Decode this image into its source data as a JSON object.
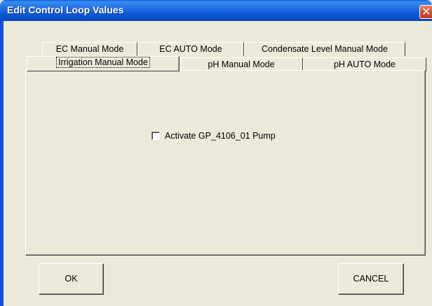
{
  "window": {
    "title": "Edit Control Loop Values",
    "close_glyph": "✕"
  },
  "tabs": {
    "row_back": [
      {
        "label": "EC Manual Mode"
      },
      {
        "label": "EC AUTO Mode"
      },
      {
        "label": "Condensate Level Manual Mode"
      }
    ],
    "row_front": [
      {
        "label": "Irrigation Manual Mode",
        "selected": true
      },
      {
        "label": "pH Manual Mode",
        "selected": false
      },
      {
        "label": "pH AUTO Mode",
        "selected": false
      }
    ]
  },
  "panel": {
    "checkbox": {
      "label": "Activate GP_4106_01 Pump",
      "checked": false
    }
  },
  "buttons": {
    "ok_label": "OK",
    "cancel_label": "CANCEL"
  },
  "colors": {
    "titlebar": "#0a54d2",
    "face": "#ece9d8",
    "close": "#d6482a"
  }
}
